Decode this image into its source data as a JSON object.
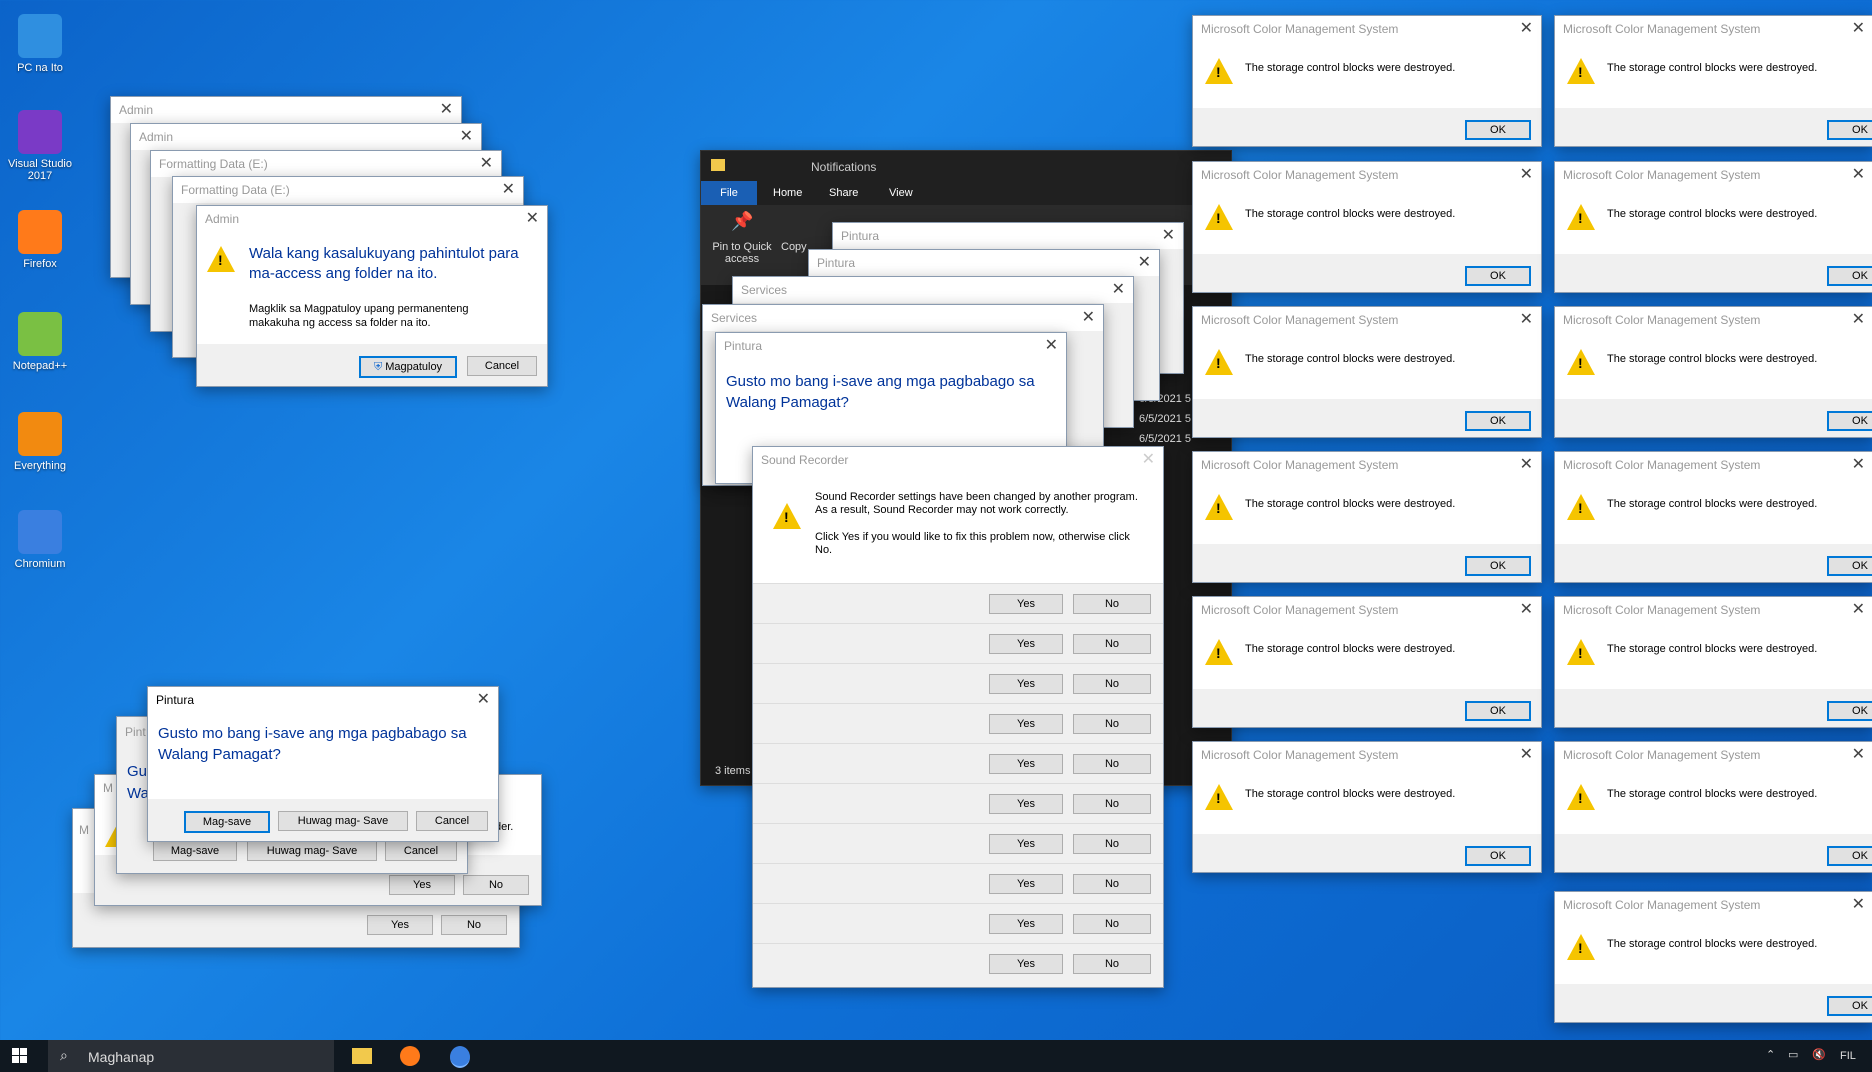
{
  "desktop": {
    "icons": [
      {
        "label": "PC na Ito",
        "color": "#2f8fe0"
      },
      {
        "label": "Visual Studio 2017",
        "color": "#7a3ac6"
      },
      {
        "label": "Firefox",
        "color": "#ff7a1a"
      },
      {
        "label": "Notepad++",
        "color": "#7ac043"
      },
      {
        "label": "Everything",
        "color": "#f28a10"
      },
      {
        "label": "Chromium",
        "color": "#3a7fe0"
      }
    ]
  },
  "admin_stack": {
    "back_titles": [
      "Admin",
      "Admin",
      "Formatting Data (E:)",
      "Formatting Data (E:)"
    ],
    "front_title": "Admin",
    "heading": "Wala kang kasalukuyang pahintulot para ma-access ang folder na ito.",
    "detail": "Magklik sa Magpatuloy upang permanenteng makakuha ng access sa folder na ito.",
    "continue_label": "Magpatuloy",
    "cancel_label": "Cancel"
  },
  "pintura_front": {
    "title": "Pintura",
    "question": "Gusto mo bang i-save ang mga pagbabago sa Walang Pamagat?",
    "save_label": "Mag-save",
    "dont_save_label": "Huwag mag- Save",
    "cancel_label": "Cancel"
  },
  "pintura_back": {
    "peek_left": [
      "Pint",
      "Gu",
      "Wa",
      "M",
      "M"
    ],
    "trail_text": "der.",
    "save_label": "Mag-save",
    "dont_save_label": "Huwag mag- Save",
    "cancel_label": "Cancel",
    "yes_label": "Yes",
    "no_label": "No"
  },
  "explorer": {
    "title": "Notifications",
    "tabs": [
      "File",
      "Home",
      "Share",
      "View"
    ],
    "ribbon": {
      "pin_label": "Pin to Quick access",
      "copy_label": "Copy"
    },
    "status": "3 items",
    "dates": [
      "6/5/2021 5",
      "6/5/2021 5",
      "6/5/2021 5"
    ]
  },
  "stacked_dialogs": {
    "titles": [
      "Pintura",
      "Pintura",
      "Services",
      "Services"
    ],
    "front_title": "Pintura",
    "question": "Gusto mo bang i-save ang mga pagbabago sa Walang Pamagat?"
  },
  "sound_recorder": {
    "title": "Sound Recorder",
    "message1": "Sound Recorder settings have been changed by another program.  As a result, Sound Recorder may not work correctly.",
    "message2": "Click Yes if you would like to fix this problem now, otherwise click No.",
    "yes_label": "Yes",
    "no_label": "No",
    "row_count": 10
  },
  "mcms": {
    "title": "Microsoft Color Management System",
    "message": "The storage control blocks were destroyed.",
    "ok_label": "OK"
  },
  "taskbar": {
    "search_placeholder": "Maghanap",
    "lang": "FIL"
  }
}
